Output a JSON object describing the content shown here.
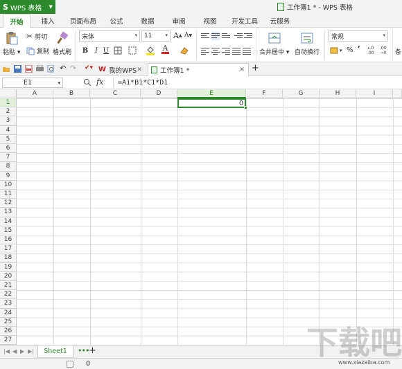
{
  "app": {
    "name": "WPS 表格",
    "logo": "S",
    "doc_title": "工作簿1 * - WPS 表格"
  },
  "menu_tabs": [
    "开始",
    "插入",
    "页面布局",
    "公式",
    "数据",
    "审阅",
    "视图",
    "开发工具",
    "云服务"
  ],
  "ribbon": {
    "paste_label": "粘贴",
    "cut_label": "剪切",
    "copy_label": "复制",
    "format_painter_label": "格式刷",
    "font_name": "宋体",
    "font_size": "11",
    "grow_font": "A",
    "shrink_font": "A",
    "bold": "B",
    "italic": "I",
    "underline": "U",
    "font_color_letter": "A",
    "merge_label": "合并居中",
    "wrap_label": "自动换行",
    "number_format": "常规",
    "percent": "%",
    "comma": "’",
    "inc_decimal": ".00",
    "dec_decimal": ".00",
    "cond_label": "条",
    "accent_color": "#2c8a2c",
    "font_color": "#e02020",
    "fill_color": "#f5e000"
  },
  "doc_tabs": [
    {
      "label": "我的WPS",
      "close": "✕"
    },
    {
      "label": "工作簿1 *",
      "close": "✕"
    }
  ],
  "new_tab": "+",
  "formula_bar": {
    "name_box": "E1",
    "fx": "fx",
    "formula": "=A1*B1*C1*D1"
  },
  "columns": [
    "A",
    "B",
    "C",
    "D",
    "E",
    "F",
    "G",
    "H",
    "I"
  ],
  "rows": [
    "1",
    "2",
    "3",
    "4",
    "5",
    "6",
    "7",
    "8",
    "9",
    "10",
    "11",
    "12",
    "13",
    "14",
    "15",
    "16",
    "17",
    "18",
    "19",
    "20",
    "21",
    "22",
    "23",
    "24",
    "25",
    "26",
    "27"
  ],
  "active_cell": {
    "ref": "E1",
    "value": "0"
  },
  "sheets": {
    "tab": "Sheet1",
    "more": "•••",
    "add": "+"
  },
  "status": {
    "value": "0"
  },
  "watermark": {
    "url": "www.xiazaiba.com"
  }
}
